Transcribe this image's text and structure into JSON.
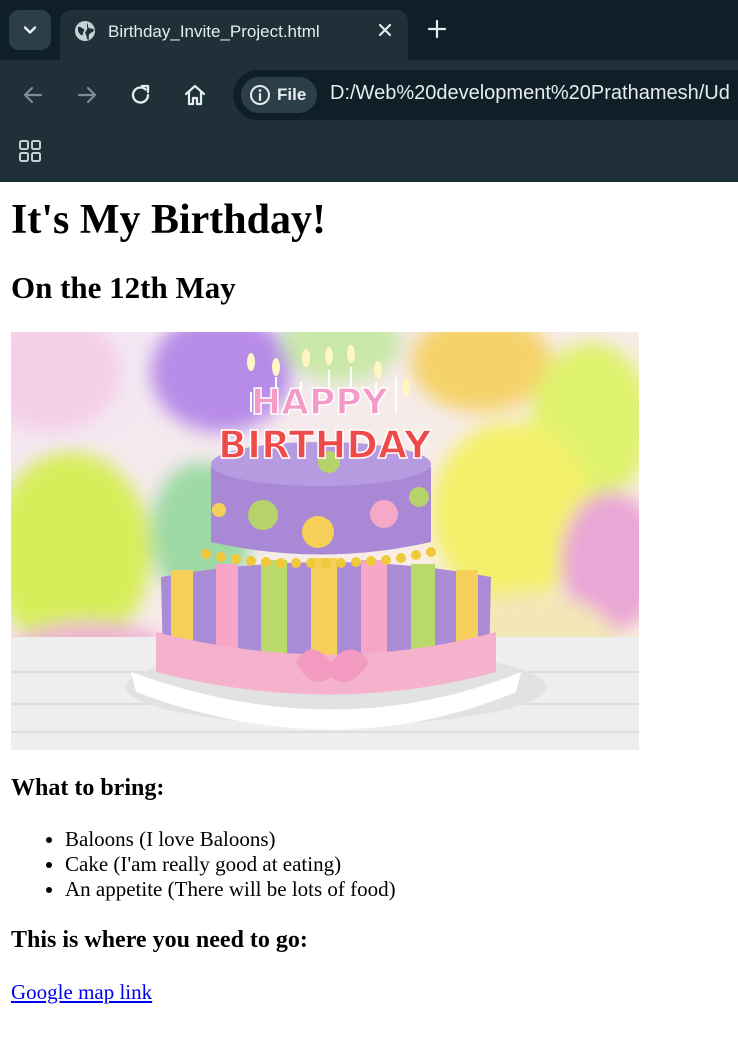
{
  "browser": {
    "tab": {
      "title": "Birthday_Invite_Project.html"
    },
    "site_chip": {
      "label": "File"
    },
    "url": "D:/Web%20development%20Prathamesh/Ud"
  },
  "page": {
    "title": "It's My Birthday!",
    "date": "On the 12th May",
    "image": {
      "icon": "birthday-cake-photo",
      "cake_text": [
        "HAPPY",
        "BIRTHDAY"
      ]
    },
    "bring_heading": "What to bring:",
    "bring_items": [
      "Baloons (I love Baloons)",
      "Cake (I'am really good at eating)",
      "An appetite (There will be lots of food)"
    ],
    "where_heading": "This is where you need to go:",
    "map_link": "Google map link"
  },
  "colors": {
    "tabstrip_bg": "#0f1f28",
    "toolbar_bg": "#1f3038",
    "link": "#0000ee"
  }
}
